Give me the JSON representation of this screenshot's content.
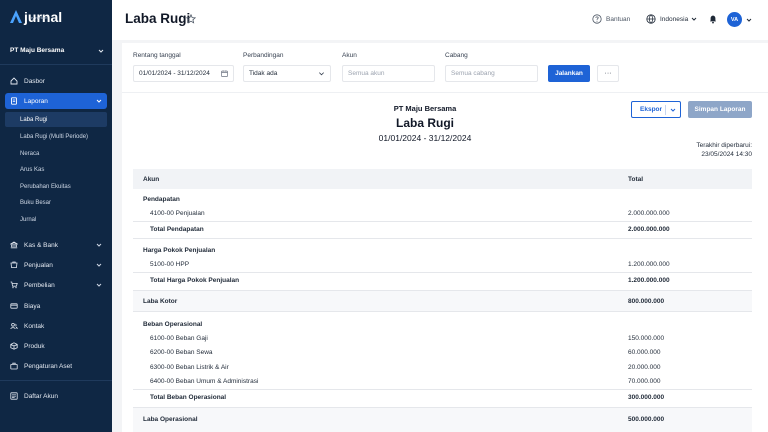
{
  "app": {
    "logo_text": "jurnal",
    "logo_sub": "by mekari",
    "company": "PT Maju Bersama"
  },
  "sidebar": {
    "items": [
      {
        "label": "Dasbor",
        "icon": "dashboard-icon"
      },
      {
        "label": "Laporan",
        "icon": "report-icon",
        "active": true
      },
      {
        "label": "Kas & Bank",
        "icon": "bank-icon"
      },
      {
        "label": "Penjualan",
        "icon": "sales-icon"
      },
      {
        "label": "Pembelian",
        "icon": "cart-icon"
      },
      {
        "label": "Biaya",
        "icon": "expense-icon"
      },
      {
        "label": "Kontak",
        "icon": "contacts-icon"
      },
      {
        "label": "Produk",
        "icon": "box-icon"
      },
      {
        "label": "Pengaturan Aset",
        "icon": "asset-icon"
      },
      {
        "label": "Daftar Akun",
        "icon": "accounts-icon"
      }
    ],
    "sub_items": [
      "Laba Rugi",
      "Laba Rugi (Multi Periode)",
      "Neraca",
      "Arus Kas",
      "Perubahan Ekuitas",
      "Buku Besar",
      "Jurnal"
    ]
  },
  "header": {
    "title": "Laba Rugi",
    "help": "Bantuan",
    "language": "Indonesia",
    "avatar": "VA"
  },
  "filters": {
    "date_range_label": "Rentang tanggal",
    "date_range_value": "01/01/2024 - 31/12/2024",
    "comparison_label": "Perbandingan",
    "comparison_value": "Tidak ada",
    "account_label": "Akun",
    "account_placeholder": "Semua akun",
    "branch_label": "Cabang",
    "branch_placeholder": "Semua cabang",
    "run_button": "Jalankan",
    "more_button": "···"
  },
  "report": {
    "company": "PT Maju Bersama",
    "title": "Laba Rugi",
    "period": "01/01/2024 - 31/12/2024",
    "export_button": "Ekspor",
    "save_button": "Simpan Laporan",
    "updated_label": "Terakhir diperbarui:",
    "updated_value": "23/05/2024 14:30",
    "col_account": "Akun",
    "col_total": "Total",
    "rows": {
      "pendapatan_header": "Pendapatan",
      "penjualan": "4100-00 Penjualan",
      "penjualan_val": "2.000.000.000",
      "total_pendapatan": "Total Pendapatan",
      "total_pendapatan_val": "2.000.000.000",
      "hpp_header": "Harga Pokok Penjualan",
      "hpp": "5100-00 HPP",
      "hpp_val": "1.200.000.000",
      "total_hpp": "Total Harga Pokok Penjualan",
      "total_hpp_val": "1.200.000.000",
      "laba_kotor": "Laba Kotor",
      "laba_kotor_val": "800.000.000",
      "beban_header": "Beban Operasional",
      "gaji": "6100-00 Beban Gaji",
      "gaji_val": "150.000.000",
      "sewa": "6200-00 Beban Sewa",
      "sewa_val": "60.000.000",
      "listrik": "6300-00 Beban Listrik & Air",
      "listrik_val": "20.000.000",
      "umum": "6400-00 Beban Umum & Administrasi",
      "umum_val": "70.000.000",
      "total_beban": "Total Beban Operasional",
      "total_beban_val": "300.000.000",
      "laba_operasional": "Laba Operasional",
      "laba_operasional_val": "500.000.000"
    }
  },
  "colors": {
    "sidebar_bg": "#0f2744",
    "accent": "#1e63d6",
    "save_button_bg": "#8ea6c8"
  }
}
